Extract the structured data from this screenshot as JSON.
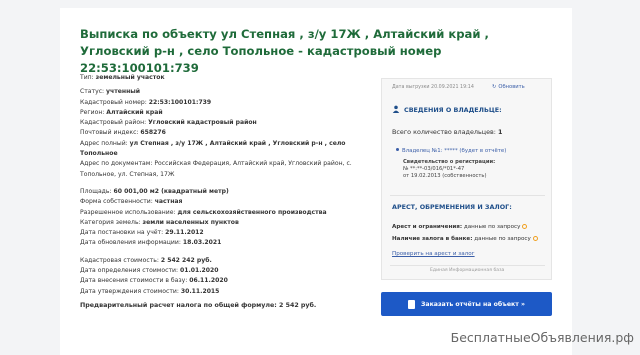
{
  "title": "Выписка по объекту ул Степная , з/у 17Ж , Алтайский край , Угловский р-н , село Топольное - кадастровый номер 22:53:100101:739",
  "object": {
    "type_label": "Тип:",
    "type_value": "земельный участок",
    "status_label": "Статус:",
    "status_value": "учтенный",
    "cadnum_label": "Кадастровый номер:",
    "cadnum_value": "22:53:100101:739",
    "region_label": "Регион:",
    "region_value": "Алтайский край",
    "district_label": "Кадастровый район:",
    "district_value": "Угловский кадастровый район",
    "zip_label": "Почтовый индекс:",
    "zip_value": "658276",
    "addr_label": "Адрес полный:",
    "addr_value": "ул Степная , з/у 17Ж , Алтайский край , Угловский р-н , село Топольное",
    "docaddr_label": "Адрес по документам:",
    "docaddr_value": "Российская Федерация, Алтайский край, Угловский район, с. Топольное, ул. Степная, 17Ж"
  },
  "details": {
    "area_label": "Площадь:",
    "area_value": "60 001,00 м2 (квадратный метр)",
    "ownership_label": "Форма собственности:",
    "ownership_value": "частная",
    "use_label": "Разрешенное использование:",
    "use_value": "для сельскохозяйственного производства",
    "category_label": "Категория земель:",
    "category_value": "земли населенных пунктов",
    "registered_label": "Дата постановки на учёт:",
    "registered_value": "29.11.2012",
    "updated_label": "Дата обновления информации:",
    "updated_value": "18.03.2021"
  },
  "cost": {
    "cost_label": "Кадастровая стоимость:",
    "cost_value": "2 542 242 руб.",
    "determined_label": "Дата определения стоимости:",
    "determined_value": "01.01.2020",
    "entered_label": "Дата внесения стоимости в базу:",
    "entered_value": "06.11.2020",
    "approved_label": "Дата утверждения стоимости:",
    "approved_value": "30.11.2015"
  },
  "tax_line": "Предварительный расчет налога по общей формуле: 2 542 руб.",
  "panel": {
    "date": "Дата выгрузки 20.09.2021 19:14",
    "refresh": "Обновить",
    "owners_heading": "СВЕДЕНИЯ О ВЛАДЕЛЬЦЕ:",
    "owners_count_label": "Всего количество владельцев:",
    "owners_count": "1",
    "owner_name": "Владелец №1:",
    "owner_masked": "*****",
    "owner_note": "(будет в отчёте)",
    "reg_title": "Свидетельство о регистрации:",
    "reg_number": "№ **:**-03/016/*01*-47",
    "reg_date": "от 19.02.2013 (собственность)",
    "arrest_heading": "АРЕСТ, ОБРЕМЕНЕНИЯ И ЗАЛОГ:",
    "arrest_label": "Арест и ограничения:",
    "arrest_value": "данные по запросу",
    "pledge_label": "Наличие залога в банке:",
    "pledge_value": "данные по запросу",
    "check_link": "Проверить на арест и залог",
    "source": "Единая Информационная база"
  },
  "cta": "Заказать отчёты на объект »",
  "watermark": "БесплатныеОбъявления.рф",
  "colors": {
    "title": "#1f6b3a",
    "accent": "#1d59c6",
    "link": "#3a5ea8",
    "warn": "#f0a020"
  }
}
